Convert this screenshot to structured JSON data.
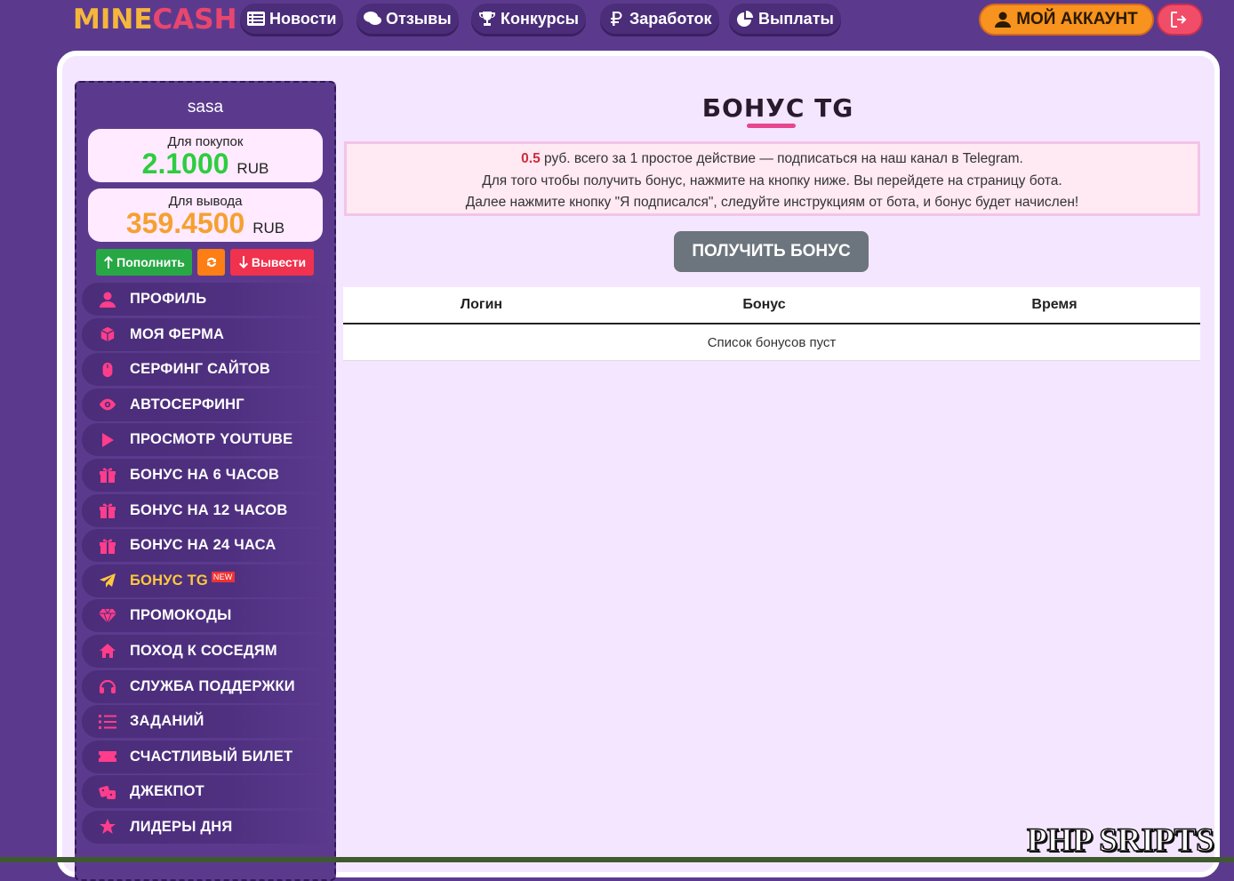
{
  "header": {
    "logo_part1": "MINE",
    "logo_part2": "CASH",
    "nav": [
      {
        "label": "Новости",
        "icon": "list-icon"
      },
      {
        "label": "Отзывы",
        "icon": "comments-icon"
      },
      {
        "label": "Конкурсы",
        "icon": "trophy-icon"
      },
      {
        "label": "Заработок",
        "icon": "ruble-icon"
      },
      {
        "label": "Выплаты",
        "icon": "pie-chart-icon"
      }
    ],
    "account_label": "МОЙ АККАУНТ"
  },
  "sidebar": {
    "username": "sasa",
    "purchase_label": "Для покупок",
    "purchase_value": "2.1000",
    "withdraw_label": "Для вывода",
    "withdraw_value": "359.4500",
    "currency": "RUB",
    "deposit_label": "Пополнить",
    "withdraw_btn_label": "Вывести",
    "menu": [
      {
        "label": "ПРОФИЛЬ",
        "icon": "user-icon"
      },
      {
        "label": "МОЯ ФЕРМА",
        "icon": "cube-icon"
      },
      {
        "label": "СЕРФИНГ САЙТОВ",
        "icon": "mouse-icon"
      },
      {
        "label": "АВТОСЕРФИНГ",
        "icon": "eye-icon"
      },
      {
        "label": "ПРОСМОТР YOUTUBE",
        "icon": "play-icon"
      },
      {
        "label": "БОНУС НА 6 ЧАСОВ",
        "icon": "gift-icon"
      },
      {
        "label": "БОНУС НА 12 ЧАСОВ",
        "icon": "gift-icon"
      },
      {
        "label": "БОНУС НА 24 ЧАСА",
        "icon": "gift-icon"
      },
      {
        "label": "БОНУС TG",
        "icon": "paper-plane-icon",
        "badge": "NEW"
      },
      {
        "label": "ПРОМОКОДЫ",
        "icon": "diamond-icon"
      },
      {
        "label": "ПОХОД К СОСЕДЯМ",
        "icon": "home-icon"
      },
      {
        "label": "СЛУЖБА ПОДДЕРЖКИ",
        "icon": "headphones-icon"
      },
      {
        "label": "ЗАДАНИЙ",
        "icon": "tasks-icon"
      },
      {
        "label": "СЧАСТЛИВЫЙ БИЛЕТ",
        "icon": "ticket-icon"
      },
      {
        "label": "ДЖЕКПОТ",
        "icon": "dice-icon"
      },
      {
        "label": "ЛИДЕРЫ ДНЯ",
        "icon": "star-icon"
      }
    ]
  },
  "main": {
    "title": "БОНУС TG",
    "info_amount": "0.5",
    "info_line1": " руб. всего за 1 простое действие — подписаться на наш канал в Telegram.",
    "info_line2": "Для того чтобы получить бонус, нажмите на кнопку ниже. Вы перейдете на страницу бота.",
    "info_line3": "Далее нажмите кнопку \"Я подписался\", следуйте инструкциям от бота, и бонус будет начислен!",
    "get_bonus_label": "ПОЛУЧИТЬ БОНУС",
    "table": {
      "columns": [
        "Логин",
        "Бонус",
        "Время"
      ],
      "empty_text": "Список бонусов пуст"
    }
  },
  "watermark": "PHP SRIPTS",
  "colors": {
    "background": "#5b3a8e",
    "accent_pink": "#ff3d8b",
    "active_yellow": "#ffc83d",
    "account_orange": "#f7931e",
    "green_balance": "#2ecc40",
    "orange_balance": "#f5a030"
  }
}
